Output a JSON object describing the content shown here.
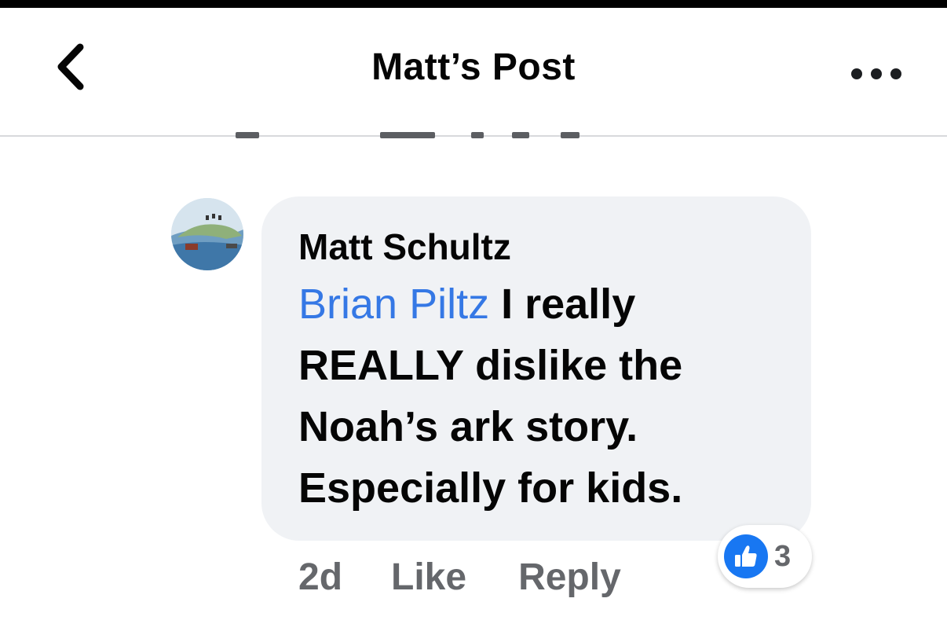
{
  "header": {
    "title": "Matt’s Post",
    "back_icon": "chevron-left-icon",
    "more_icon": "more-horizontal-icon"
  },
  "comment": {
    "author": "Matt Schultz",
    "mention": "Brian Piltz",
    "text_line1": " I really",
    "text_line2": "REALLY dislike the",
    "text_line3": "Noah’s ark story.",
    "text_line4": "Especially for kids.",
    "time": "2d",
    "like_label": "Like",
    "reply_label": "Reply",
    "reaction_count": "3",
    "reaction_icon": "like-thumb-icon"
  },
  "colors": {
    "mention": "#3578e5",
    "like_blue": "#1877f2",
    "bubble": "#f0f2f5",
    "secondary_text": "#65676b"
  }
}
